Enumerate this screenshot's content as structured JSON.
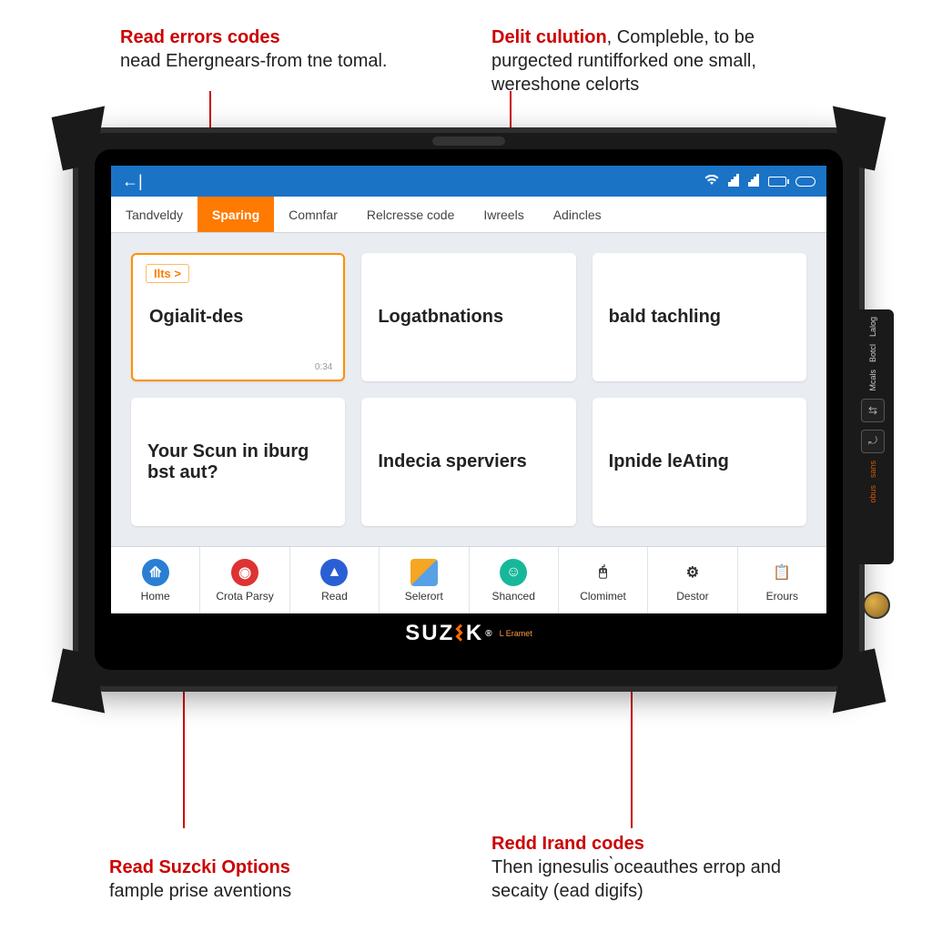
{
  "callouts": {
    "tl": {
      "headline": "Read errors codes",
      "body": "nead Ehergnears-from tne tomal."
    },
    "tr": {
      "headline": "Delit culution",
      "body": ", Compleble, to be purgected runtifforked one small, wereshone celorts"
    },
    "bl": {
      "headline": "Read Suzcki Options",
      "body": "fample prise aventions"
    },
    "br": {
      "headline": "Redd Irand codes",
      "body": "Then ignesulis ̀oceauthes errop and secaity (ead digifs)"
    }
  },
  "statusbar": {
    "back_glyph": "←|"
  },
  "tabs": [
    {
      "label": "Tandveldy",
      "active": false
    },
    {
      "label": "Sparing",
      "active": true
    },
    {
      "label": "Comnfar",
      "active": false
    },
    {
      "label": "Relcresse code",
      "active": false
    },
    {
      "label": "Iwreels",
      "active": false
    },
    {
      "label": "Adincles",
      "active": false
    }
  ],
  "tiles": [
    {
      "badge": "Ilts >",
      "label": "Ogialit-des",
      "tiny": "0:34",
      "selected": true
    },
    {
      "label": "Logatbnations"
    },
    {
      "label": "bald tachling"
    },
    {
      "label": "Your Scun in iburg bst aut?"
    },
    {
      "label": "Indecia sperviers"
    },
    {
      "label": "Ipnide leAting"
    }
  ],
  "toolbar": [
    {
      "icon": "home",
      "label": "Home"
    },
    {
      "icon": "stop",
      "label": "Crota Parsy"
    },
    {
      "icon": "read",
      "label": "Read"
    },
    {
      "icon": "selerort",
      "label": "Selerort"
    },
    {
      "icon": "shanced",
      "label": "Shanced"
    },
    {
      "icon": "clomimet",
      "label": "Clomimet"
    },
    {
      "icon": "destor",
      "label": "Destor"
    },
    {
      "icon": "erours",
      "label": "Erours"
    }
  ],
  "side_module": {
    "top_labels": [
      "Lalog",
      "Botcl",
      "Mcals"
    ],
    "buttons": [
      "⇆",
      "⤾"
    ],
    "red_labels": [
      "sans",
      "obus"
    ]
  },
  "brand": {
    "name_left": "SUZ",
    "name_right": "K",
    "tagline": "L Eramet",
    "reg": "®"
  }
}
